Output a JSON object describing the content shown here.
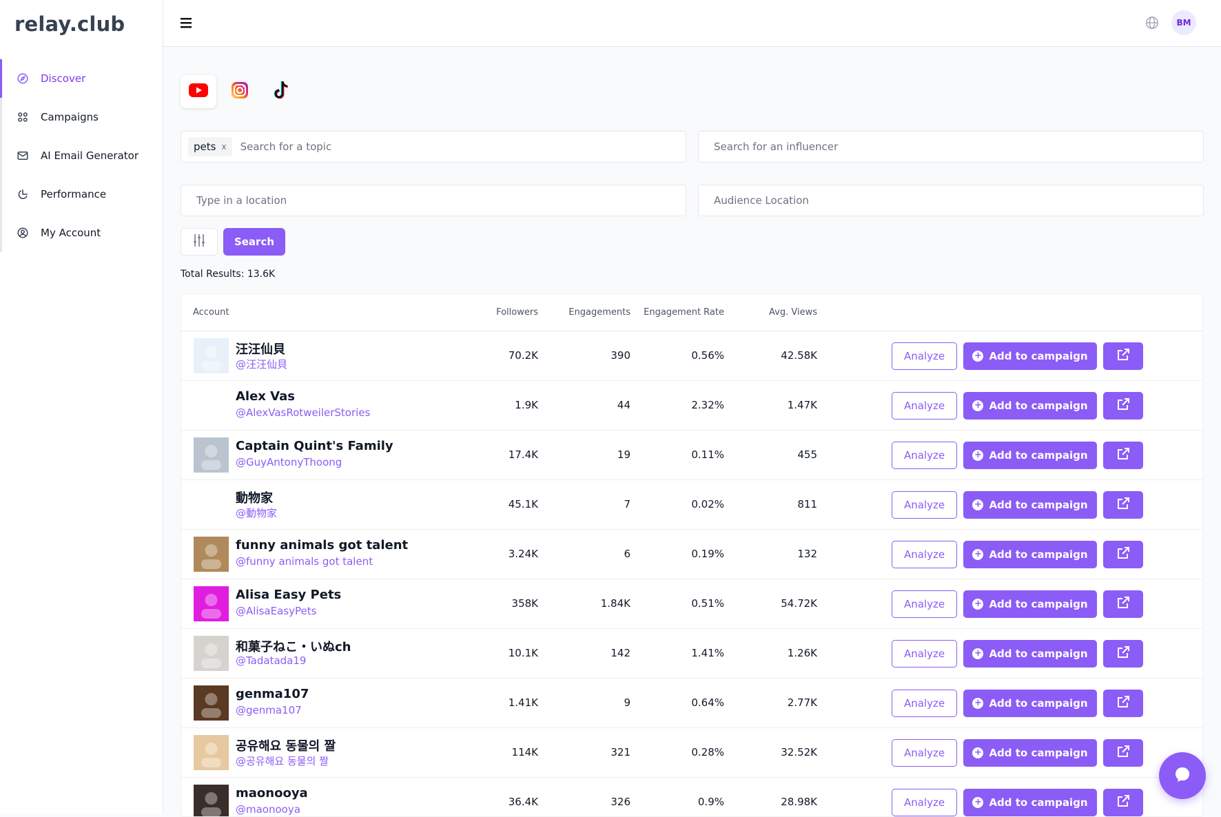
{
  "brand": "relay.club",
  "sidebar": {
    "items": [
      {
        "label": "Discover",
        "icon": "compass-icon",
        "active": true
      },
      {
        "label": "Campaigns",
        "icon": "grid-icon"
      },
      {
        "label": "AI Email Generator",
        "icon": "mail-icon"
      },
      {
        "label": "Performance",
        "icon": "pie-chart-icon"
      },
      {
        "label": "My Account",
        "icon": "user-circle-icon"
      }
    ]
  },
  "topbar": {
    "avatar_initials": "BM"
  },
  "platforms": [
    "youtube",
    "instagram",
    "tiktok"
  ],
  "search": {
    "topic_chip": "pets",
    "topic_chip_remove": "x",
    "topic_placeholder": "Search for a topic",
    "influencer_placeholder": "Search for an influencer",
    "location_placeholder": "Type in a location",
    "audience_location_placeholder": "Audience Location",
    "search_label": "Search"
  },
  "total_results": "Total Results: 13.6K",
  "table": {
    "headers": {
      "account": "Account",
      "followers": "Followers",
      "engagements": "Engagements",
      "rate": "Engagement Rate",
      "views": "Avg. Views"
    },
    "analyze_label": "Analyze",
    "add_label": "Add to campaign",
    "rows": [
      {
        "name": "汪汪仙貝",
        "handle": "@汪汪仙貝",
        "followers": "70.2K",
        "engagements": "390",
        "rate": "0.56%",
        "views": "42.58K",
        "avatar": "#e8f1f8"
      },
      {
        "name": "Alex Vas",
        "handle": "@AlexVasRotweilerStories",
        "followers": "1.9K",
        "engagements": "44",
        "rate": "2.32%",
        "views": "1.47K",
        "avatar": "#ffffff"
      },
      {
        "name": "Captain Quint's Family",
        "handle": "@GuyAntonyThoong",
        "followers": "17.4K",
        "engagements": "19",
        "rate": "0.11%",
        "views": "455",
        "avatar": "#b9c4cf"
      },
      {
        "name": "動物家",
        "handle": "@動物家",
        "followers": "45.1K",
        "engagements": "7",
        "rate": "0.02%",
        "views": "811",
        "avatar": "#ffffff"
      },
      {
        "name": "funny animals got talent",
        "handle": "@funny animals got talent",
        "followers": "3.24K",
        "engagements": "6",
        "rate": "0.19%",
        "views": "132",
        "avatar": "#b08a5a"
      },
      {
        "name": "Alisa Easy Pets",
        "handle": "@AlisaEasyPets",
        "followers": "358K",
        "engagements": "1.84K",
        "rate": "0.51%",
        "views": "54.72K",
        "avatar": "#e01ee0"
      },
      {
        "name": "和菓子ねこ・いぬch",
        "handle": "@Tadatada19",
        "followers": "10.1K",
        "engagements": "142",
        "rate": "1.41%",
        "views": "1.26K",
        "avatar": "#d6d3cf"
      },
      {
        "name": "genma107",
        "handle": "@genma107",
        "followers": "1.41K",
        "engagements": "9",
        "rate": "0.64%",
        "views": "2.77K",
        "avatar": "#5a3a22"
      },
      {
        "name": "공유해요 동물의 짤",
        "handle": "@공유해요 동물의 짤",
        "followers": "114K",
        "engagements": "321",
        "rate": "0.28%",
        "views": "32.52K",
        "avatar": "#e6c9a0"
      },
      {
        "name": "maonooya",
        "handle": "@maonooya",
        "followers": "36.4K",
        "engagements": "326",
        "rate": "0.9%",
        "views": "28.98K",
        "avatar": "#3a2e2a"
      }
    ]
  },
  "colors": {
    "accent": "#8b5cf6",
    "youtube": "#ff0000"
  }
}
